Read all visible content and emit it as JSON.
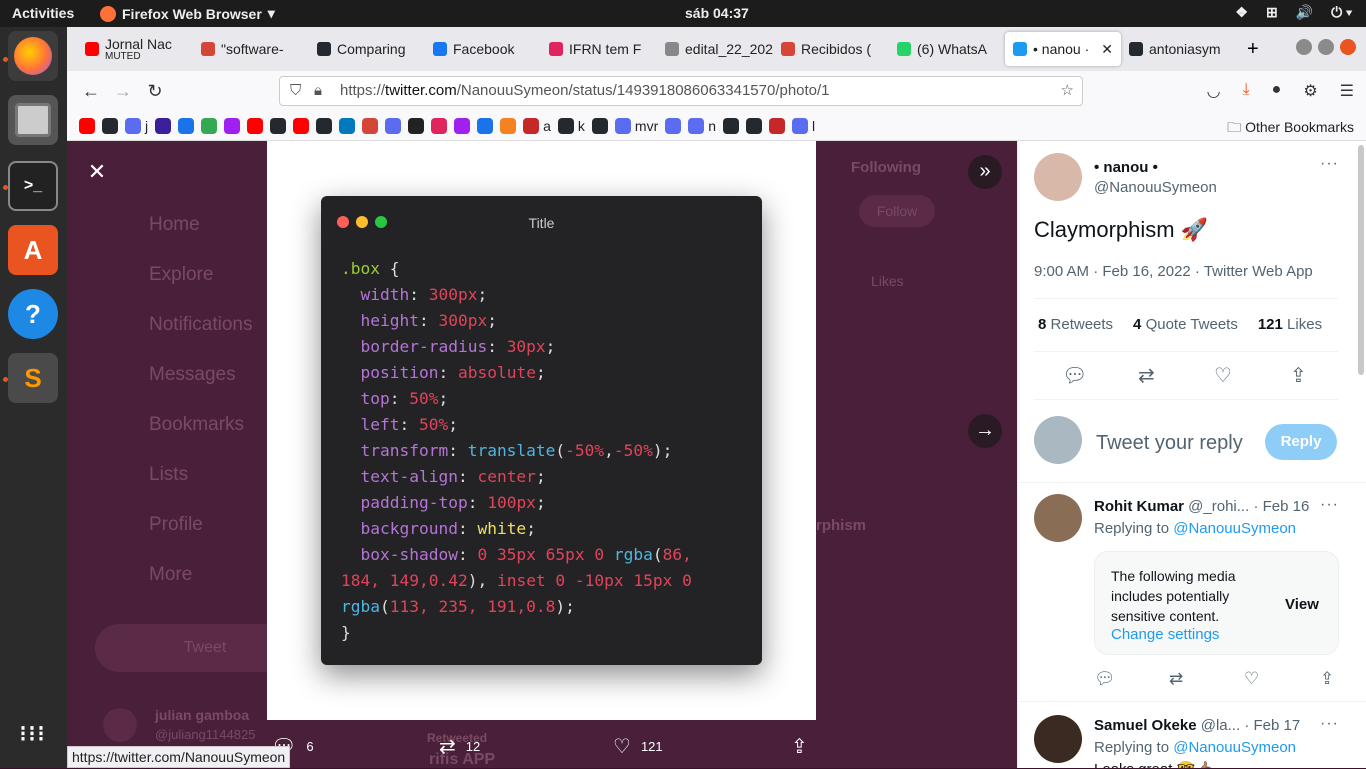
{
  "os": {
    "activities": "Activities",
    "app_name": "Firefox Web Browser",
    "clock": "sáb 04:37"
  },
  "tabs": [
    {
      "title": "Jornal Nac",
      "sub": "MUTED",
      "icon_color": "#ff0000"
    },
    {
      "title": "\"software-",
      "icon_color": "#d44638"
    },
    {
      "title": "Comparing",
      "icon_color": "#24292f"
    },
    {
      "title": "Facebook",
      "icon_color": "#1877f2"
    },
    {
      "title": "IFRN tem F",
      "icon_color": "#e0245e"
    },
    {
      "title": "edital_22_202",
      "icon_color": "#888888"
    },
    {
      "title": "Recibidos (",
      "icon_color": "#d44638"
    },
    {
      "title": "(6) WhatsA",
      "icon_color": "#25d366"
    },
    {
      "title": "• nanou ·",
      "icon_color": "#1d9bf0",
      "active": true
    },
    {
      "title": "antoniasym",
      "icon_color": "#24292f"
    }
  ],
  "url": {
    "prefix": "https://",
    "host": "twitter.com",
    "path": "/NanouuSymeon/status/1493918086063341570/photo/1"
  },
  "bookmarks": [
    {
      "label": "",
      "color": "#ff0000"
    },
    {
      "label": "",
      "color": "#24292f"
    },
    {
      "label": "j",
      "color": "#5b6cf0"
    },
    {
      "label": "",
      "color": "#3b1f9b"
    },
    {
      "label": "",
      "color": "#1a73e8"
    },
    {
      "label": "",
      "color": "#34a853"
    },
    {
      "label": "",
      "color": "#a020f0"
    },
    {
      "label": "",
      "color": "#ff0000"
    },
    {
      "label": "",
      "color": "#24292f"
    },
    {
      "label": "",
      "color": "#ff0000"
    },
    {
      "label": "",
      "color": "#24292f"
    },
    {
      "label": "",
      "color": "#0079bf"
    },
    {
      "label": "",
      "color": "#d44638"
    },
    {
      "label": "",
      "color": "#5b6cf0"
    },
    {
      "label": "",
      "color": "#222222"
    },
    {
      "label": "",
      "color": "#e0245e"
    },
    {
      "label": "",
      "color": "#a020f0"
    },
    {
      "label": "",
      "color": "#1a73e8"
    },
    {
      "label": "",
      "color": "#f58220"
    },
    {
      "label": "a",
      "color": "#c62828"
    },
    {
      "label": "k",
      "color": "#24292f"
    },
    {
      "label": "",
      "color": "#24292f"
    },
    {
      "label": "mvr",
      "color": "#5b6cf0"
    },
    {
      "label": "",
      "color": "#5b6cf0"
    },
    {
      "label": "n",
      "color": "#5b6cf0"
    },
    {
      "label": "",
      "color": "#24292f"
    },
    {
      "label": "",
      "color": "#24292f"
    },
    {
      "label": "",
      "color": "#c62828"
    },
    {
      "label": "l",
      "color": "#5b6cf0"
    }
  ],
  "other_bookmarks": "Other Bookmarks",
  "background_nav": [
    "Home",
    "Explore",
    "Notifications",
    "Messages",
    "Bookmarks",
    "Lists",
    "Profile",
    "More"
  ],
  "background_tweet_btn": "Tweet",
  "background_user": {
    "name": "julian gamboa",
    "handle": "@juliang1144825"
  },
  "background_right": {
    "following": "Following",
    "follow": "Follow",
    "likes": "Likes",
    "fragment": "rphism",
    "retweeted": "Retweeted",
    "app": "rifis APP"
  },
  "code_window": {
    "title": "Title",
    "lines": [
      [
        {
          "t": ".box",
          "c": "sel"
        },
        {
          "t": " {",
          "c": ""
        }
      ],
      [
        {
          "t": "  width",
          "c": "prop"
        },
        {
          "t": ": ",
          "c": ""
        },
        {
          "t": "300px",
          "c": "val"
        },
        {
          "t": ";",
          "c": ""
        }
      ],
      [
        {
          "t": "  height",
          "c": "prop"
        },
        {
          "t": ": ",
          "c": ""
        },
        {
          "t": "300px",
          "c": "val"
        },
        {
          "t": ";",
          "c": ""
        }
      ],
      [
        {
          "t": "  border-radius",
          "c": "prop"
        },
        {
          "t": ": ",
          "c": ""
        },
        {
          "t": "30px",
          "c": "val"
        },
        {
          "t": ";",
          "c": ""
        }
      ],
      [
        {
          "t": "  position",
          "c": "prop"
        },
        {
          "t": ": ",
          "c": ""
        },
        {
          "t": "absolute",
          "c": "val"
        },
        {
          "t": ";",
          "c": ""
        }
      ],
      [
        {
          "t": "  top",
          "c": "prop"
        },
        {
          "t": ": ",
          "c": ""
        },
        {
          "t": "50%",
          "c": "val"
        },
        {
          "t": ";",
          "c": ""
        }
      ],
      [
        {
          "t": "  left",
          "c": "prop"
        },
        {
          "t": ": ",
          "c": ""
        },
        {
          "t": "50%",
          "c": "val"
        },
        {
          "t": ";",
          "c": ""
        }
      ],
      [
        {
          "t": "  transform",
          "c": "prop"
        },
        {
          "t": ": ",
          "c": ""
        },
        {
          "t": "translate",
          "c": "fn"
        },
        {
          "t": "(",
          "c": ""
        },
        {
          "t": "-50%",
          "c": "val"
        },
        {
          "t": ",",
          "c": ""
        },
        {
          "t": "-50%",
          "c": "val"
        },
        {
          "t": ");",
          "c": ""
        }
      ],
      [
        {
          "t": "  text-align",
          "c": "prop"
        },
        {
          "t": ": ",
          "c": ""
        },
        {
          "t": "center",
          "c": "val"
        },
        {
          "t": ";",
          "c": ""
        }
      ],
      [
        {
          "t": "  padding-top",
          "c": "prop"
        },
        {
          "t": ": ",
          "c": ""
        },
        {
          "t": "100px",
          "c": "val"
        },
        {
          "t": ";",
          "c": ""
        }
      ],
      [
        {
          "t": "  background",
          "c": "prop"
        },
        {
          "t": ": ",
          "c": ""
        },
        {
          "t": "white",
          "c": "kw"
        },
        {
          "t": ";",
          "c": ""
        }
      ],
      [
        {
          "t": "  box-shadow",
          "c": "prop"
        },
        {
          "t": ": ",
          "c": ""
        },
        {
          "t": "0 35px 65px 0 ",
          "c": "val"
        },
        {
          "t": "rgba",
          "c": "fn"
        },
        {
          "t": "(",
          "c": ""
        },
        {
          "t": "86,",
          "c": "val"
        }
      ],
      [
        {
          "t": "184, 149,0.42",
          "c": "val"
        },
        {
          "t": "), ",
          "c": ""
        },
        {
          "t": "inset 0 -10px 15px 0",
          "c": "val"
        }
      ],
      [
        {
          "t": "rgba",
          "c": "fn"
        },
        {
          "t": "(",
          "c": ""
        },
        {
          "t": "113, 235, 191,0.8",
          "c": "val"
        },
        {
          "t": ");",
          "c": ""
        }
      ],
      [
        {
          "t": "}",
          "c": ""
        }
      ]
    ]
  },
  "photo_actions": {
    "replies": "6",
    "retweets": "12",
    "likes": "121"
  },
  "status_url": "https://twitter.com/NanouuSymeon",
  "tweet": {
    "name": "• nanou •",
    "handle": "@NanouuSymeon",
    "text": "Claymorphism 🚀",
    "meta": "9:00 AM · Feb 16, 2022 · Twitter Web App",
    "retweets_count": "8",
    "retweets_label": "Retweets",
    "quotes_count": "4",
    "quotes_label": "Quote Tweets",
    "likes_count": "121",
    "likes_label": "Likes"
  },
  "reply_box": {
    "placeholder": "Tweet your reply",
    "button": "Reply"
  },
  "replies": [
    {
      "name": "Rohit Kumar",
      "handle": "@_rohi...",
      "date": "· Feb 16",
      "replying": "Replying to",
      "to": "@NanouuSymeon",
      "sensitive": "The following media includes potentially sensitive content.",
      "change": "Change settings",
      "view": "View"
    },
    {
      "name": "Samuel Okeke",
      "handle": "@la...",
      "date": "· Feb 17",
      "replying": "Replying to",
      "to": "@NanouuSymeon",
      "text": "Looks great 🤓👍🏽"
    }
  ]
}
